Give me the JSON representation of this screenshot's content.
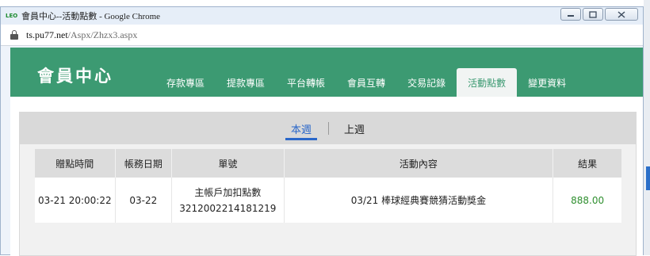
{
  "browser": {
    "logo_text": "LEO",
    "title": "會員中心--活動點數 - Google Chrome",
    "url_host": "ts.pu77.net",
    "url_path": "/Aspx/Zhzx3.aspx"
  },
  "header": {
    "brand": "會員中心",
    "nav": [
      {
        "label": "存款專區",
        "active": false
      },
      {
        "label": "提款專區",
        "active": false
      },
      {
        "label": "平台轉帳",
        "active": false
      },
      {
        "label": "會員互轉",
        "active": false
      },
      {
        "label": "交易記錄",
        "active": false
      },
      {
        "label": "活動點數",
        "active": true
      },
      {
        "label": "變更資料",
        "active": false
      }
    ]
  },
  "subtabs": {
    "this_week": "本週",
    "last_week": "上週"
  },
  "table": {
    "headers": [
      "贈點時間",
      "帳務日期",
      "單號",
      "活動內容",
      "結果"
    ],
    "rows": [
      {
        "time": "03-21 20:00:22",
        "date": "03-22",
        "order_line1": "主帳戶加扣點數",
        "order_line2": "3212002214181219",
        "content": "03/21 棒球經典賽競猜活動獎金",
        "result": "888.00"
      }
    ]
  },
  "colors": {
    "header_green": "#3c9a72",
    "active_tab_blue": "#2a67c9",
    "result_green": "#2f8f2f"
  }
}
